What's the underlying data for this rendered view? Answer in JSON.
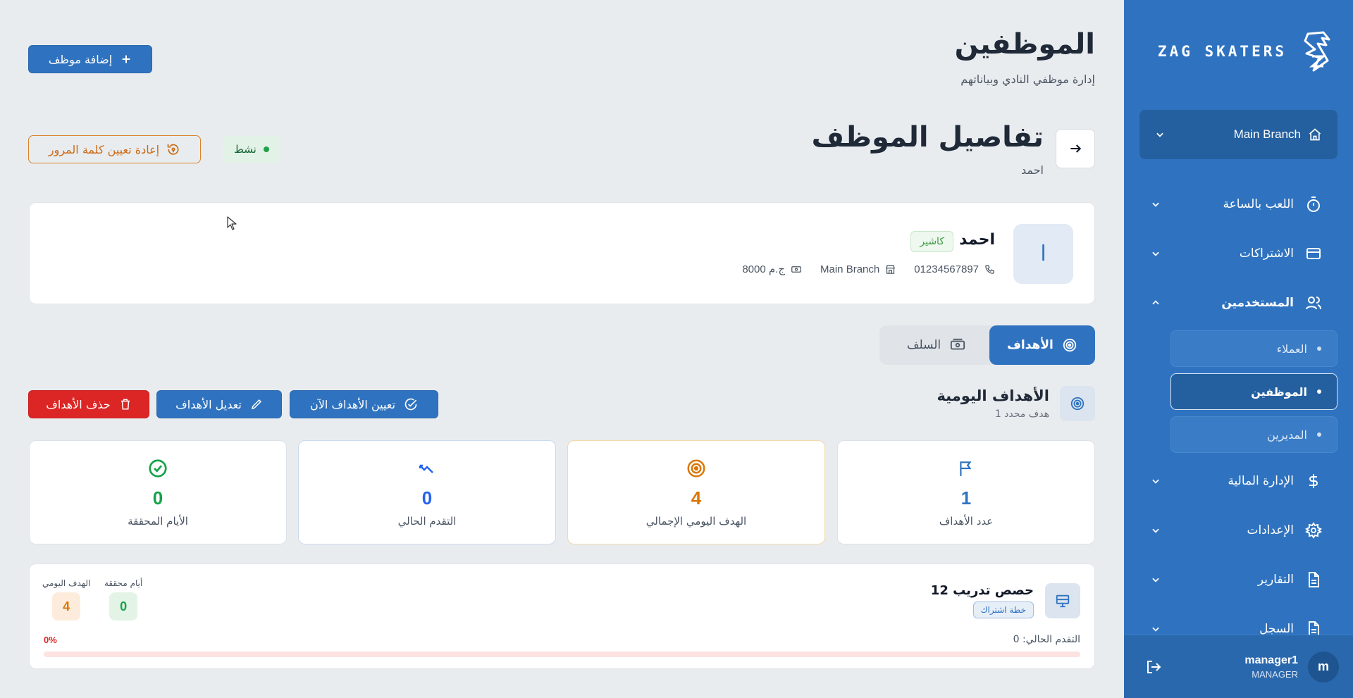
{
  "sidebar": {
    "brand": "ZAG SKATERS",
    "branch": "Main Branch",
    "nav": {
      "hourly": "اللعب بالساعة",
      "subscriptions": "الاشتراكات",
      "users": "المستخدمين",
      "finance": "الإدارة المالية",
      "settings": "الإعدادات",
      "reports": "التقارير",
      "logs": "السجل"
    },
    "sub": {
      "clients": "العملاء",
      "employees": "الموظفين",
      "managers": "المديرين"
    },
    "user": {
      "initial": "m",
      "name": "manager1",
      "role": "MANAGER"
    }
  },
  "header": {
    "title": "الموظفين",
    "subtitle": "إدارة موظفي النادي وبياناتهم",
    "add_button": "إضافة موظف"
  },
  "details": {
    "title": "تفاصيل الموظف",
    "subtitle": "احمد",
    "status": "نشط",
    "reset_password": "إعادة تعيين كلمة المرور"
  },
  "employee": {
    "initial": "ا",
    "name": "احمد",
    "role": "كاشير",
    "phone": "01234567897",
    "branch": "Main Branch",
    "salary": "8000 ج.م"
  },
  "tabs": {
    "goals": "الأهداف",
    "advances": "السلف"
  },
  "goals_section": {
    "title": "الأهداف اليومية",
    "subtitle": "1 هدف محدد",
    "assign_button": "تعيين الأهداف الآن",
    "edit_button": "تعديل الأهداف",
    "delete_button": "حذف الأهداف"
  },
  "stats": {
    "goal_count": {
      "value": "1",
      "label": "عدد الأهداف"
    },
    "daily_total": {
      "value": "4",
      "label": "الهدف اليومي الإجمالي"
    },
    "current_progress": {
      "value": "0",
      "label": "التقدم الحالي"
    },
    "days_achieved": {
      "value": "0",
      "label": "الأيام المحققة"
    }
  },
  "plan": {
    "title": "12 حصص تدريب",
    "badge": "خطة اشتراك",
    "achieved_label": "أيام محققة",
    "achieved_value": "0",
    "daily_label": "الهدف اليومي",
    "daily_value": "4",
    "progress_label": "التقدم الحالي: 0",
    "progress_pct": "0%",
    "progress_fraction": 0
  },
  "colors": {
    "primary": "#2f73c0",
    "danger": "#dc2626",
    "success": "#16a34a",
    "warning": "#d97706"
  }
}
